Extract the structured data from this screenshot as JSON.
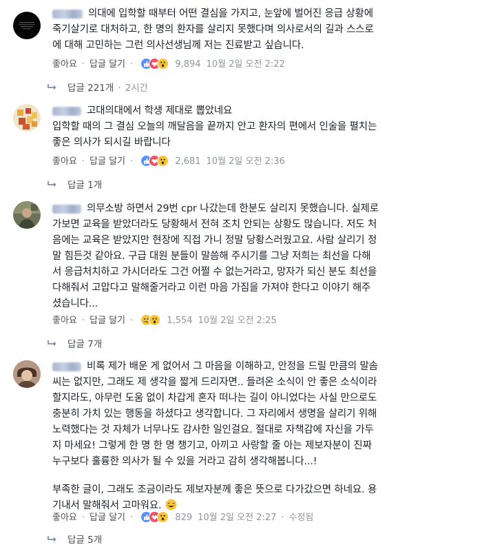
{
  "comments": [
    {
      "lines": [
        "의대에 입학할 때부터 어떤 결심을 가지고, 눈앞에 벌어진 응급 상황에",
        "죽기살기로 대처하고, 한 명의 환자를 살리지 못했다며 의사로서의 길과 스스로",
        "에 대해 고민하는 그런 의사선생님께 저는 진료받고 싶습니다."
      ],
      "like_label": "좋아요",
      "reply_label": "답글 달기",
      "reaction_count": "9,894",
      "time": "10월 2일 오전 2:22",
      "reactions": [
        "like",
        "love",
        "wow"
      ],
      "replies_label": "답글 221개",
      "replies_time": "2시간"
    },
    {
      "lines": [
        "고대의대에서 학생 제대로 뽑았네요",
        "입학할 때의 그 결심 오늘의 깨달음을 끝까지 안고 환자의 편에서 인술을 펼치는",
        "좋은 의사가 되시길 바랍니다"
      ],
      "like_label": "좋아요",
      "reply_label": "답글 달기",
      "reaction_count": "2,681",
      "time": "10월 2일 오전 2:36",
      "reactions": [
        "like",
        "love",
        "wow"
      ],
      "replies_label": "답글 1개"
    },
    {
      "lines": [
        "의무소방 하면서 29번 cpr 나갔는데 한분도 살리지 못했습니다. 실제로",
        "가보면 교육을 받았더라도 당황해서 전혀 조치 안되는 상황도 많습니다. 저도 처",
        "음에는 교육은 받았지만 현장에 직접 가니 정말 당황스러웠고요. 사람 살리기 정",
        "말 힘든것 같아요. 구급 대원 분들이 말씀해 주시기를 그냥 저희는 최선을 다해",
        "서 응급처치하고 가시더라도 그건 어쩔 수 없는거라고, 망자가 되신 분도 최선을",
        "다해줘서 고맙다고 말해줄거라고 이런 마음 가짐을 가져야 한다고 이야기 해주",
        "셨습니다..."
      ],
      "like_label": "좋아요",
      "reply_label": "답글 달기",
      "reaction_count": "1,554",
      "time": "10월 2일 오전 2:25",
      "reactions": [
        "sad",
        "wow"
      ],
      "replies_label": "답글 7개"
    },
    {
      "lines": [
        "비록 제가 배운 게 없어서 그 마음을 이해하고, 안정을 드릴 만큼의 말솜",
        "씨는 없지만, 그래도 제 생각을 짧게 드리자면.. 들려온 소식이 안 좋은 소식이라",
        "할지라도, 아무런 도움 없이 차갑게 혼자 떠나는 길이 아니었다는 사실 만으로도",
        "충분히 가치 있는 행동을 하셨다고 생각합니다. 그 자리에서 생명을 살리기 위해",
        "노력했다는 것 자체가 너무나도 감사한 일인걸요. 절대로 자책감에 자신을 가두",
        "지 마세요! 그렇게 한 명 한 명 챙기고, 아끼고 사랑할 줄 아는 제보자분이 진짜",
        "누구보다 훌륭한 의사가 될 수 있을 거라고 감히 생각해봅니다...!"
      ],
      "extra_lines": [
        "부족한 글이, 그래도 조금이라도 제보자분께 좋은 뜻으로 다가갔으면 하네요. 용",
        "기내서 말해줘서 고마워요."
      ],
      "like_label": "좋아요",
      "reply_label": "답글 달기",
      "reaction_count": "829",
      "time": "10월 2일 오전 2:27",
      "edited": "수정됨",
      "reactions": [
        "like",
        "love",
        "wow"
      ],
      "replies_label": "답글 5개"
    }
  ],
  "colors": {
    "text": "#1d2129",
    "meta": "#90949c",
    "link": "#4b4f56",
    "like": "#5890ff",
    "love": "#f25268",
    "wow": "#f7c43a"
  },
  "icons": [
    "reply-arrow-icon",
    "like-reaction-icon",
    "love-reaction-icon",
    "wow-reaction-icon",
    "sad-reaction-icon",
    "smile-emoji-icon"
  ]
}
